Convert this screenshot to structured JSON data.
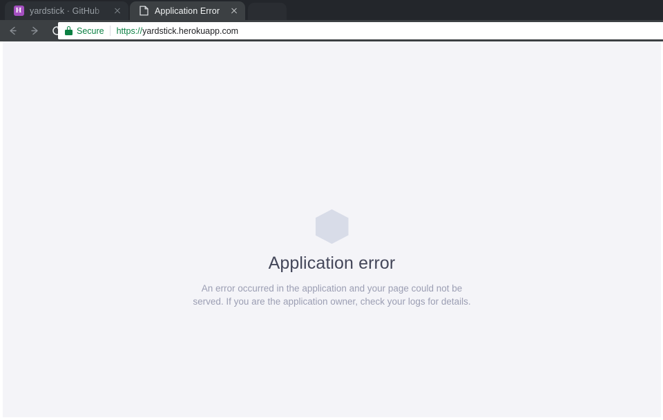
{
  "browser": {
    "tabs": [
      {
        "title": "yardstick · GitHub",
        "favicon": "heroku-h-icon",
        "favicon_glyph": "H",
        "active": false,
        "close_label": "close-tab"
      },
      {
        "title": "Application Error",
        "favicon": "document-page-icon",
        "active": true,
        "close_label": "close-tab"
      }
    ],
    "toolbar": {
      "back_label": "Back",
      "forward_label": "Forward",
      "reload_label": "Reload",
      "security_icon": "lock-icon",
      "security_label": "Secure",
      "url_scheme": "https://",
      "url_host": "yardstick.herokuapp.com",
      "url_full": "https://yardstick.herokuapp.com"
    },
    "colors": {
      "tab_strip": "#23262b",
      "toolbar": "#3c4043",
      "active_tab": "#3c4043",
      "inactive_tab": "#2c3035",
      "secure_green": "#0b8043",
      "favicon_purple": "#a44fc0"
    }
  },
  "page": {
    "icon": "hexagon-icon",
    "heading": "Application error",
    "body": "An error occurred in the application and your page could not be served. If you are the application owner, check your logs for details.",
    "colors": {
      "background": "#f4f4f8",
      "hexagon": "#d8dce8",
      "heading": "#44475a",
      "body": "#9b9eb3"
    }
  }
}
